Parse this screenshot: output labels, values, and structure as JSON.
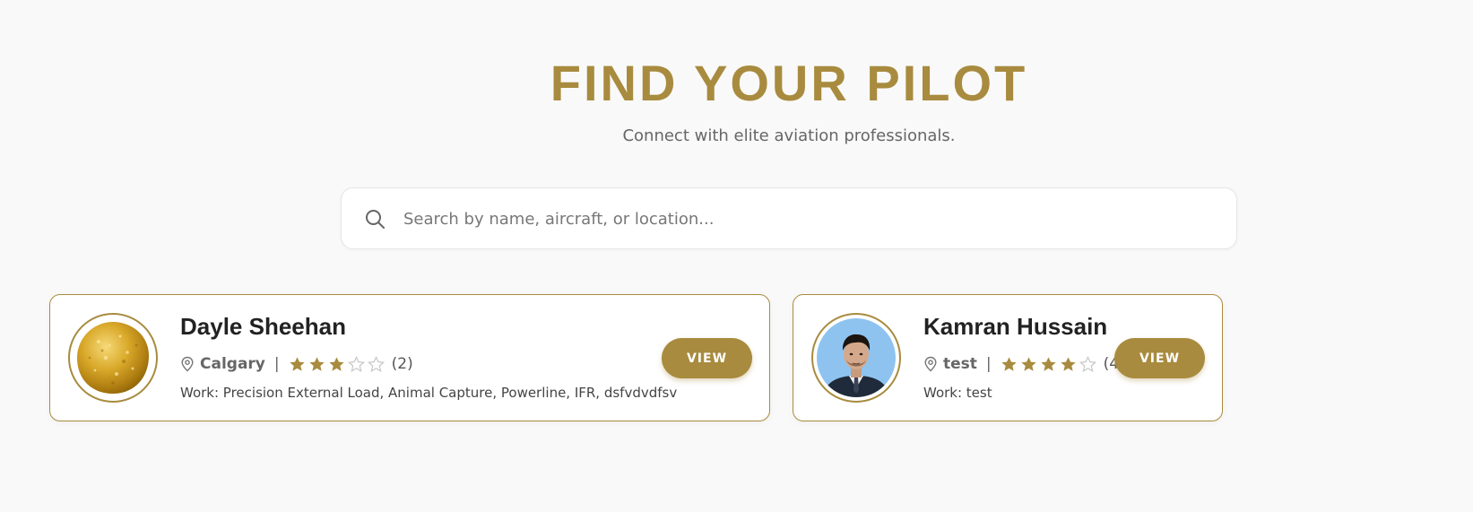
{
  "hero": {
    "title": "FIND YOUR PILOT",
    "subtitle": "Connect with elite aviation professionals."
  },
  "search": {
    "icon": "search-icon",
    "placeholder": "Search by name, aircraft, or location...",
    "value": ""
  },
  "colors": {
    "accent": "#a88b3e",
    "background": "#f9f9f9",
    "card_background": "#ffffff",
    "star_empty": "#c8c8c8"
  },
  "pilots": [
    {
      "name": "Dayle Sheehan",
      "location": "Calgary",
      "separator": "|",
      "rating": 3,
      "rating_max": 5,
      "review_count": "(2)",
      "work": "Work: Precision External Load, Animal Capture, Powerline, IFR, dsfvdvdfsv",
      "avatar": "gold-texture-avatar",
      "button_label": "VIEW"
    },
    {
      "name": "Kamran Hussain",
      "location": "test",
      "separator": "|",
      "rating": 4,
      "rating_max": 5,
      "review_count": "(4)",
      "work": "Work: test",
      "avatar": "portrait-photo-avatar",
      "button_label": "VIEW"
    }
  ]
}
